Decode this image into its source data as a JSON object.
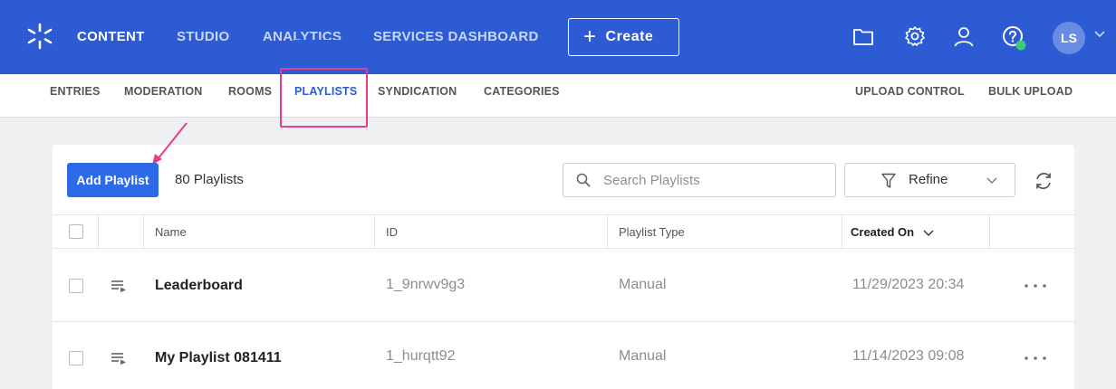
{
  "topnav": {
    "items": [
      {
        "label": "CONTENT",
        "active": true
      },
      {
        "label": "STUDIO",
        "active": false
      },
      {
        "label": "ANALYTICS",
        "active": false
      },
      {
        "label": "SERVICES DASHBOARD",
        "active": false
      }
    ],
    "create_label": "Create",
    "icons": [
      "folder-icon",
      "gear-icon",
      "user-icon",
      "help-icon"
    ],
    "avatar_initials": "LS"
  },
  "subnav": {
    "left": [
      {
        "label": "ENTRIES",
        "active": false
      },
      {
        "label": "MODERATION",
        "active": false
      },
      {
        "label": "ROOMS",
        "active": false
      },
      {
        "label": "PLAYLISTS",
        "active": true
      },
      {
        "label": "SYNDICATION",
        "active": false
      },
      {
        "label": "CATEGORIES",
        "active": false
      }
    ],
    "right": [
      {
        "label": "UPLOAD CONTROL"
      },
      {
        "label": "BULK UPLOAD"
      }
    ]
  },
  "toolbar": {
    "add_label": "Add Playlist",
    "count_text": "80 Playlists",
    "search_placeholder": "Search Playlists",
    "refine_label": "Refine"
  },
  "table": {
    "columns": [
      "Name",
      "ID",
      "Playlist Type",
      "Created On"
    ],
    "sorted_column": "Created On",
    "rows": [
      {
        "name": "Leaderboard",
        "id": "1_9nrwv9g3",
        "type": "Manual",
        "created": "11/29/2023 20:34"
      },
      {
        "name": "My Playlist 081411",
        "id": "1_hurqtt92",
        "type": "Manual",
        "created": "11/14/2023 09:08"
      }
    ]
  },
  "colors": {
    "brand": "#2d5bd4",
    "button": "#2d6ae8",
    "annotation": "#e63e8d",
    "status_dot": "#3dcc75"
  }
}
